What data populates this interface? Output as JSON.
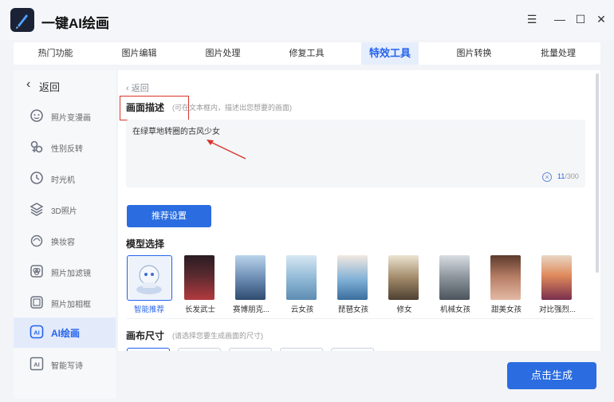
{
  "app": {
    "title": "一键AI绘画"
  },
  "window": {
    "menu": "☰",
    "minimize": "—",
    "maximize": "☐",
    "close": "✕"
  },
  "nav": {
    "tabs": [
      {
        "label": "热门功能"
      },
      {
        "label": "图片编辑"
      },
      {
        "label": "图片处理"
      },
      {
        "label": "修复工具"
      },
      {
        "label": "特效工具",
        "active": true
      },
      {
        "label": "图片转换"
      },
      {
        "label": "批量处理"
      }
    ]
  },
  "sidebar": {
    "back_label": "返回",
    "items": [
      {
        "label": "照片变漫画",
        "icon": "face-icon"
      },
      {
        "label": "性别反转",
        "icon": "gender-icon"
      },
      {
        "label": "时光机",
        "icon": "clock-icon"
      },
      {
        "label": "3D照片",
        "icon": "layers-icon"
      },
      {
        "label": "换妆容",
        "icon": "makeup-icon"
      },
      {
        "label": "照片加滤镜",
        "icon": "filter-icon"
      },
      {
        "label": "照片加相框",
        "icon": "frame-icon"
      },
      {
        "label": "AI绘画",
        "icon": "ai-icon",
        "active": true
      },
      {
        "label": "智能写诗",
        "icon": "ai-poem-icon"
      }
    ]
  },
  "main": {
    "back_label": "返回",
    "desc": {
      "title": "画面描述",
      "hint": "(可在文本框内，描述出您想要的画面)",
      "value": "在绿草地转圈的古风少女",
      "count": "11",
      "max": "/300"
    },
    "recommend_label": "推荐设置",
    "model": {
      "title": "模型选择",
      "items": [
        {
          "label": "智能推荐",
          "selected": true
        },
        {
          "label": "长发武士"
        },
        {
          "label": "赛博朋克..."
        },
        {
          "label": "云女孩"
        },
        {
          "label": "琵琶女孩"
        },
        {
          "label": "修女"
        },
        {
          "label": "机械女孩"
        },
        {
          "label": "甜美女孩"
        },
        {
          "label": "对比强烈..."
        }
      ]
    },
    "canvas": {
      "title": "画布尺寸",
      "hint": "(请选择您要生成画面的尺寸)"
    }
  },
  "generate_label": "点击生成",
  "colors": {
    "accent": "#2b6de0",
    "highlight": "#d9342b"
  }
}
